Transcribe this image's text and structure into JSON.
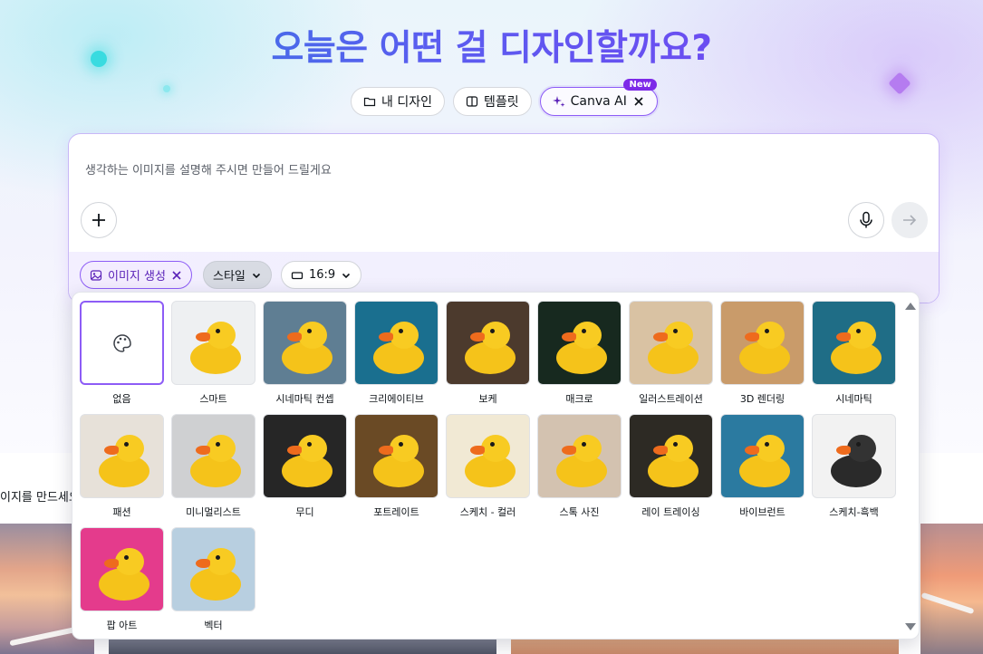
{
  "headline": "오늘은 어떤 걸 디자인할까요?",
  "tabs": [
    {
      "label": "내 디자인",
      "icon": "folder-icon"
    },
    {
      "label": "템플릿",
      "icon": "template-icon"
    },
    {
      "label": "Canva AI",
      "icon": "sparkle-icon",
      "badge": "New",
      "active": true
    }
  ],
  "prompt": {
    "placeholder": "생각하는 이미지를 설명해 주시면 만들어 드릴게요",
    "chips": {
      "image_generate": "이미지 생성",
      "style": "스타일",
      "ratio": "16:9"
    }
  },
  "left_partial_text": "이지를 만드세요",
  "style_picker": {
    "items": [
      {
        "label": "없음",
        "selected": true,
        "bg": "#ffffff"
      },
      {
        "label": "스마트",
        "bg": "#eef0f2"
      },
      {
        "label": "시네마틱 컨셉",
        "bg": "#5f7e93"
      },
      {
        "label": "크리에이티브",
        "bg": "#1a6f8f"
      },
      {
        "label": "보케",
        "bg": "#4c3a2d"
      },
      {
        "label": "매크로",
        "bg": "#17291f"
      },
      {
        "label": "일러스트레이션",
        "bg": "#d9c2a3"
      },
      {
        "label": "3D 렌더링",
        "bg": "#c99b6a"
      },
      {
        "label": "시네마틱",
        "bg": "#1f6d86"
      },
      {
        "label": "패션",
        "bg": "#e7e1d9"
      },
      {
        "label": "미니멀리스트",
        "bg": "#cfd0d2"
      },
      {
        "label": "무디",
        "bg": "#262626"
      },
      {
        "label": "포트레이트",
        "bg": "#6a4a25"
      },
      {
        "label": "스케치 - 컬러",
        "bg": "#f1e9d4"
      },
      {
        "label": "스톡 사진",
        "bg": "#d3c2b0"
      },
      {
        "label": "레이 트레이싱",
        "bg": "#2d2a24"
      },
      {
        "label": "바이브런트",
        "bg": "#2b7aa0"
      },
      {
        "label": "스케치-흑백",
        "bg": "#f2f2f2"
      },
      {
        "label": "팝 아트",
        "bg": "#e43b8c"
      },
      {
        "label": "벡터",
        "bg": "#b8cfe0"
      }
    ]
  }
}
